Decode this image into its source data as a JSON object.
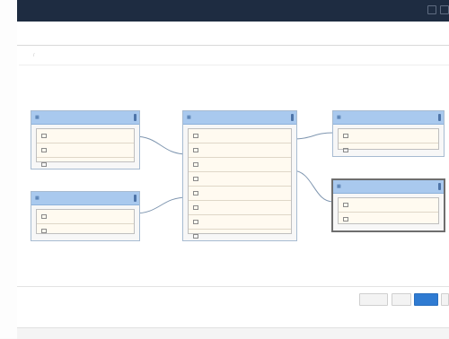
{
  "window": {
    "title": "",
    "controls": [
      "minimize-icon",
      "close-icon"
    ]
  },
  "header": {
    "page_title": ""
  },
  "breadcrumb": {
    "parent": "",
    "separator": "/",
    "current": ""
  },
  "canvas": {
    "toolbar_glyph": ""
  },
  "tables": {
    "left_top": {
      "name": "",
      "fields": [
        "",
        "",
        ""
      ]
    },
    "left_bottom": {
      "name": "",
      "fields": [
        "",
        ""
      ]
    },
    "center": {
      "name": "",
      "fields": [
        "",
        "",
        "",
        "",
        "",
        "",
        "",
        ""
      ]
    },
    "right_top": {
      "name": "",
      "fields": [
        "",
        ""
      ]
    },
    "right_bottom": {
      "name": "",
      "fields": [
        "",
        ""
      ]
    }
  },
  "footer": {
    "buttons": [
      "",
      "",
      "",
      ""
    ]
  },
  "statusbar": {
    "text": ""
  },
  "colors": {
    "titlebar": "#1e2c41",
    "table_header": "#a9c9ee",
    "primary": "#2f7bd2",
    "field_bg": "#fffaf0"
  }
}
